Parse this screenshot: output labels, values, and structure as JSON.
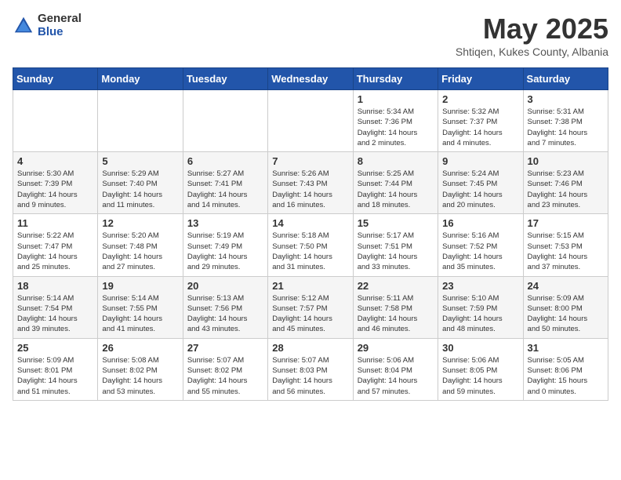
{
  "header": {
    "logo_general": "General",
    "logo_blue": "Blue",
    "title": "May 2025",
    "subtitle": "Shtiqen, Kukes County, Albania"
  },
  "weekdays": [
    "Sunday",
    "Monday",
    "Tuesday",
    "Wednesday",
    "Thursday",
    "Friday",
    "Saturday"
  ],
  "weeks": [
    [
      {
        "day": "",
        "info": ""
      },
      {
        "day": "",
        "info": ""
      },
      {
        "day": "",
        "info": ""
      },
      {
        "day": "",
        "info": ""
      },
      {
        "day": "1",
        "info": "Sunrise: 5:34 AM\nSunset: 7:36 PM\nDaylight: 14 hours\nand 2 minutes."
      },
      {
        "day": "2",
        "info": "Sunrise: 5:32 AM\nSunset: 7:37 PM\nDaylight: 14 hours\nand 4 minutes."
      },
      {
        "day": "3",
        "info": "Sunrise: 5:31 AM\nSunset: 7:38 PM\nDaylight: 14 hours\nand 7 minutes."
      }
    ],
    [
      {
        "day": "4",
        "info": "Sunrise: 5:30 AM\nSunset: 7:39 PM\nDaylight: 14 hours\nand 9 minutes."
      },
      {
        "day": "5",
        "info": "Sunrise: 5:29 AM\nSunset: 7:40 PM\nDaylight: 14 hours\nand 11 minutes."
      },
      {
        "day": "6",
        "info": "Sunrise: 5:27 AM\nSunset: 7:41 PM\nDaylight: 14 hours\nand 14 minutes."
      },
      {
        "day": "7",
        "info": "Sunrise: 5:26 AM\nSunset: 7:43 PM\nDaylight: 14 hours\nand 16 minutes."
      },
      {
        "day": "8",
        "info": "Sunrise: 5:25 AM\nSunset: 7:44 PM\nDaylight: 14 hours\nand 18 minutes."
      },
      {
        "day": "9",
        "info": "Sunrise: 5:24 AM\nSunset: 7:45 PM\nDaylight: 14 hours\nand 20 minutes."
      },
      {
        "day": "10",
        "info": "Sunrise: 5:23 AM\nSunset: 7:46 PM\nDaylight: 14 hours\nand 23 minutes."
      }
    ],
    [
      {
        "day": "11",
        "info": "Sunrise: 5:22 AM\nSunset: 7:47 PM\nDaylight: 14 hours\nand 25 minutes."
      },
      {
        "day": "12",
        "info": "Sunrise: 5:20 AM\nSunset: 7:48 PM\nDaylight: 14 hours\nand 27 minutes."
      },
      {
        "day": "13",
        "info": "Sunrise: 5:19 AM\nSunset: 7:49 PM\nDaylight: 14 hours\nand 29 minutes."
      },
      {
        "day": "14",
        "info": "Sunrise: 5:18 AM\nSunset: 7:50 PM\nDaylight: 14 hours\nand 31 minutes."
      },
      {
        "day": "15",
        "info": "Sunrise: 5:17 AM\nSunset: 7:51 PM\nDaylight: 14 hours\nand 33 minutes."
      },
      {
        "day": "16",
        "info": "Sunrise: 5:16 AM\nSunset: 7:52 PM\nDaylight: 14 hours\nand 35 minutes."
      },
      {
        "day": "17",
        "info": "Sunrise: 5:15 AM\nSunset: 7:53 PM\nDaylight: 14 hours\nand 37 minutes."
      }
    ],
    [
      {
        "day": "18",
        "info": "Sunrise: 5:14 AM\nSunset: 7:54 PM\nDaylight: 14 hours\nand 39 minutes."
      },
      {
        "day": "19",
        "info": "Sunrise: 5:14 AM\nSunset: 7:55 PM\nDaylight: 14 hours\nand 41 minutes."
      },
      {
        "day": "20",
        "info": "Sunrise: 5:13 AM\nSunset: 7:56 PM\nDaylight: 14 hours\nand 43 minutes."
      },
      {
        "day": "21",
        "info": "Sunrise: 5:12 AM\nSunset: 7:57 PM\nDaylight: 14 hours\nand 45 minutes."
      },
      {
        "day": "22",
        "info": "Sunrise: 5:11 AM\nSunset: 7:58 PM\nDaylight: 14 hours\nand 46 minutes."
      },
      {
        "day": "23",
        "info": "Sunrise: 5:10 AM\nSunset: 7:59 PM\nDaylight: 14 hours\nand 48 minutes."
      },
      {
        "day": "24",
        "info": "Sunrise: 5:09 AM\nSunset: 8:00 PM\nDaylight: 14 hours\nand 50 minutes."
      }
    ],
    [
      {
        "day": "25",
        "info": "Sunrise: 5:09 AM\nSunset: 8:01 PM\nDaylight: 14 hours\nand 51 minutes."
      },
      {
        "day": "26",
        "info": "Sunrise: 5:08 AM\nSunset: 8:02 PM\nDaylight: 14 hours\nand 53 minutes."
      },
      {
        "day": "27",
        "info": "Sunrise: 5:07 AM\nSunset: 8:02 PM\nDaylight: 14 hours\nand 55 minutes."
      },
      {
        "day": "28",
        "info": "Sunrise: 5:07 AM\nSunset: 8:03 PM\nDaylight: 14 hours\nand 56 minutes."
      },
      {
        "day": "29",
        "info": "Sunrise: 5:06 AM\nSunset: 8:04 PM\nDaylight: 14 hours\nand 57 minutes."
      },
      {
        "day": "30",
        "info": "Sunrise: 5:06 AM\nSunset: 8:05 PM\nDaylight: 14 hours\nand 59 minutes."
      },
      {
        "day": "31",
        "info": "Sunrise: 5:05 AM\nSunset: 8:06 PM\nDaylight: 15 hours\nand 0 minutes."
      }
    ]
  ]
}
